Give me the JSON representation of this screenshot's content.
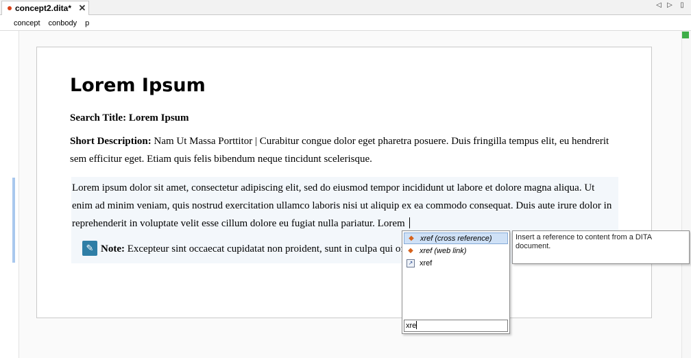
{
  "tab": {
    "title": "concept2.dita*",
    "close_glyph": "✕"
  },
  "tab_nav": {
    "prev_glyph": "◁",
    "next_glyph": "▷",
    "menu_glyph": "▯"
  },
  "breadcrumb": [
    "concept",
    "conbody",
    "p"
  ],
  "document": {
    "title": "Lorem Ipsum",
    "search_title_label": "Search Title:",
    "search_title_value": "Lorem Ipsum",
    "short_desc_label": "Short Description:",
    "short_desc_value": "Nam Ut Massa Porttitor | Curabitur congue dolor eget pharetra posuere. Duis fringilla tempus elit, eu hendrerit sem efficitur eget. Etiam quis felis bibendum neque tincidunt scelerisque.",
    "paragraph": "Lorem ipsum dolor sit amet, consectetur adipiscing elit, sed do eiusmod tempor incididunt ut labore et dolore magna aliqua. Ut enim ad minim veniam, quis nostrud exercitation ullamco laboris nisi ut aliquip ex ea commodo consequat. Duis aute irure dolor in reprehenderit in voluptate velit esse cillum dolore eu fugiat nulla pariatur. Lorem",
    "note_label": "Note:",
    "note_text": "Excepteur sint occaecat cupidatat non proident, sunt in culpa qui officia deserunt mollit anim id est laborum."
  },
  "icons": {
    "note_icon_glyph": "✎",
    "element_icon_glyph": "◆",
    "xref_icon_glyph": "↗"
  },
  "completion": {
    "items": [
      {
        "label": "xref (cross reference)",
        "icon": "element-diamond-icon",
        "selected": true
      },
      {
        "label": "xref (web link)",
        "icon": "element-diamond-icon",
        "selected": false
      },
      {
        "label": "xref",
        "icon": "xref-element-icon",
        "selected": false
      }
    ],
    "filter_value": "xre",
    "tooltip": "Insert a reference to content from a DITA document."
  },
  "colors": {
    "modified_dot": "#d9421a",
    "selection": "#cfe1f6",
    "note_icon": "#2f7ea6",
    "status_ok": "#3fae49",
    "gutter_marker": "#a9c8ee"
  }
}
